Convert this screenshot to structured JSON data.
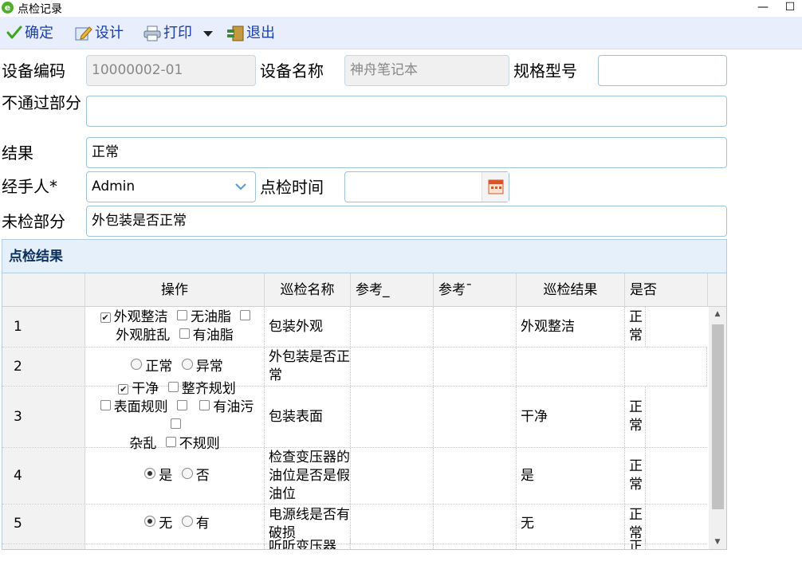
{
  "window": {
    "title": "点检记录",
    "minimize_symbol": "—",
    "maximize_symbol": "☐"
  },
  "toolbar": {
    "confirm": "确定",
    "design": "设计",
    "print": "打印",
    "exit": "退出"
  },
  "form": {
    "device_code_label": "设备编码",
    "device_code_value": "10000002-01",
    "device_name_label": "设备名称",
    "device_name_value": "神舟笔记本",
    "spec_label": "规格型号",
    "spec_value": "",
    "failed_part_label": "不通过部分",
    "failed_part_value": "",
    "result_label": "结果",
    "result_value": "正常",
    "handler_label": "经手人*",
    "handler_value": "Admin",
    "inspect_time_label": "点检时间",
    "inspect_time_value": "",
    "unchecked_label": "未检部分",
    "unchecked_value": "外包装是否正常"
  },
  "panel": {
    "title": "点检结果",
    "columns": [
      "",
      "操作",
      "巡检名称",
      "参考_",
      "参考ˉ",
      "巡检结果",
      "是否"
    ],
    "rows": [
      {
        "no": "1",
        "type": "checkbox",
        "options": [
          {
            "label": "外观整洁",
            "checked": true
          },
          {
            "label": "无油脂",
            "checked": false
          },
          {
            "label": "外观脏乱",
            "checked": false
          },
          {
            "label": "有油脂",
            "checked": false
          }
        ],
        "name": "包装外观",
        "ref1": "",
        "ref2": "",
        "result": "外观整洁",
        "yesno": "正常"
      },
      {
        "no": "2",
        "type": "radio",
        "options": [
          {
            "label": "正常",
            "checked": false
          },
          {
            "label": "异常",
            "checked": false
          }
        ],
        "name": "外包装是否正常",
        "ref1": "",
        "ref2": "",
        "result": "",
        "yesno": ""
      },
      {
        "no": "3",
        "type": "checkbox",
        "options": [
          {
            "label": "干净",
            "checked": true
          },
          {
            "label": "整齐规划",
            "checked": false
          },
          {
            "label": "表面规则",
            "checked": false
          },
          {
            "label": "",
            "checked": false
          },
          {
            "label": "有油污",
            "checked": false
          },
          {
            "label": "杂乱",
            "checked": false
          },
          {
            "label": "不规则",
            "checked": false
          }
        ],
        "name": "包装表面",
        "ref1": "",
        "ref2": "",
        "result": "干净",
        "yesno": "正常"
      },
      {
        "no": "4",
        "type": "radio",
        "options": [
          {
            "label": "是",
            "checked": true
          },
          {
            "label": "否",
            "checked": false
          }
        ],
        "name": "检查变压器的油位是否是假油位",
        "ref1": "",
        "ref2": "",
        "result": "是",
        "yesno": "正常"
      },
      {
        "no": "5",
        "type": "radio",
        "options": [
          {
            "label": "无",
            "checked": true
          },
          {
            "label": "有",
            "checked": false
          }
        ],
        "name": "电源线是否有破损",
        "ref1": "",
        "ref2": "",
        "result": "无",
        "yesno": "正常"
      },
      {
        "no": "",
        "type": "radio",
        "options": [],
        "name": "听听变压器",
        "ref1": "",
        "ref2": "",
        "result": "",
        "yesno": "正"
      }
    ]
  }
}
